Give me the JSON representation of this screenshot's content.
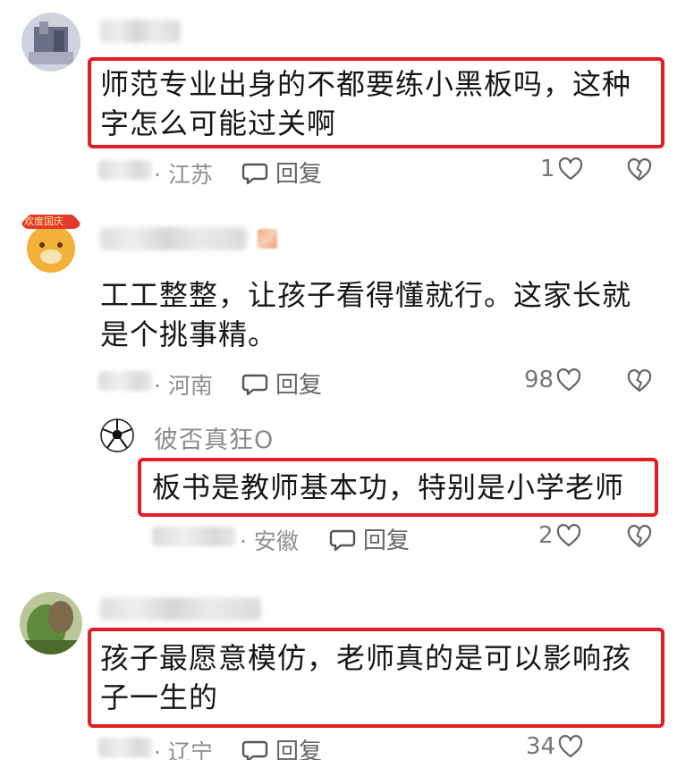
{
  "comments": [
    {
      "text_line1": "师范专业出身的不都要练小黑板吗，这种",
      "text_line2": "字怎么可能过关啊",
      "location": "· 江苏",
      "reply_label": "回复",
      "likes": "1"
    },
    {
      "text_line1": "工工整整，让孩子看得懂就行。这家长就",
      "text_line2": "是个挑事精。",
      "location": "· 河南",
      "reply_label": "回复",
      "likes": "98",
      "avatar_badge": "欢度国庆"
    },
    {
      "username": "彼否真狂O",
      "text_line1": "板书是教师基本功，特别是小学老师",
      "location": "· 安徽",
      "reply_label": "回复",
      "likes": "2"
    },
    {
      "text_line1": "孩子最愿意模仿，老师真的是可以影响孩",
      "text_line2": "子一生的",
      "location": "· 辽宁",
      "reply_label": "回复",
      "likes": "34"
    }
  ],
  "icons": {
    "reply": "speech-bubble-icon",
    "like": "heart-outline-icon",
    "dislike": "broken-heart-icon"
  },
  "colors": {
    "highlight_box": "#e21d23",
    "meta_text": "#8e8e8e"
  }
}
